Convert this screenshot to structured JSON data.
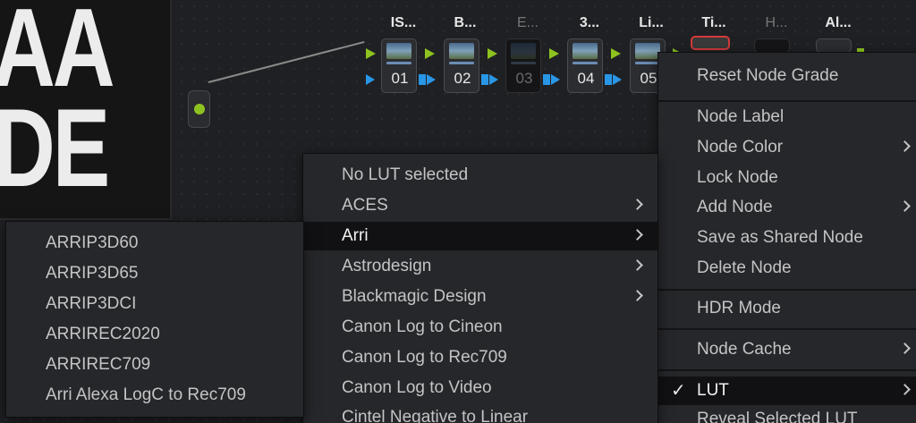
{
  "viewer": {
    "big_line_1": "AA",
    "big_line_2": "DE"
  },
  "node_labels": [
    {
      "text": "IS...",
      "dim": false
    },
    {
      "text": "B...",
      "dim": false
    },
    {
      "text": "E...",
      "dim": true
    },
    {
      "text": "3...",
      "dim": false
    },
    {
      "text": "Li...",
      "dim": false
    },
    {
      "text": "Ti...",
      "dim": false
    },
    {
      "text": "H...",
      "dim": true
    },
    {
      "text": "Al...",
      "dim": false
    }
  ],
  "nodes": [
    "01",
    "02",
    "03",
    "04",
    "05"
  ],
  "context_menu": {
    "items": {
      "reset": "Reset Node Grade",
      "label": "Node Label",
      "color": "Node Color",
      "lock": "Lock Node",
      "add": "Add Node",
      "save_shared": "Save as Shared Node",
      "delete": "Delete Node",
      "hdr": "HDR Mode",
      "cache": "Node Cache",
      "lut": "LUT",
      "reveal": "Reveal Selected LUT"
    },
    "check_glyph": "✓"
  },
  "lut_menu": {
    "items": [
      "No LUT selected",
      "ACES",
      "Arri",
      "Astrodesign",
      "Blackmagic Design",
      "Canon Log to Cineon",
      "Canon Log to Rec709",
      "Canon Log to Video",
      "Cintel Negative to Linear"
    ]
  },
  "arri_menu": {
    "items": [
      "ARRIP3D60",
      "ARRIP3D65",
      "ARRIP3DCI",
      "ARRIREC2020",
      "ARRIREC709",
      "Arri Alexa LogC to Rec709"
    ]
  },
  "colors": {
    "accent_green": "#8ec31f",
    "accent_blue": "#2a96e6",
    "selected_border": "#d23a3a",
    "menu_bg": "#26272b",
    "highlight_bg": "#111113"
  }
}
